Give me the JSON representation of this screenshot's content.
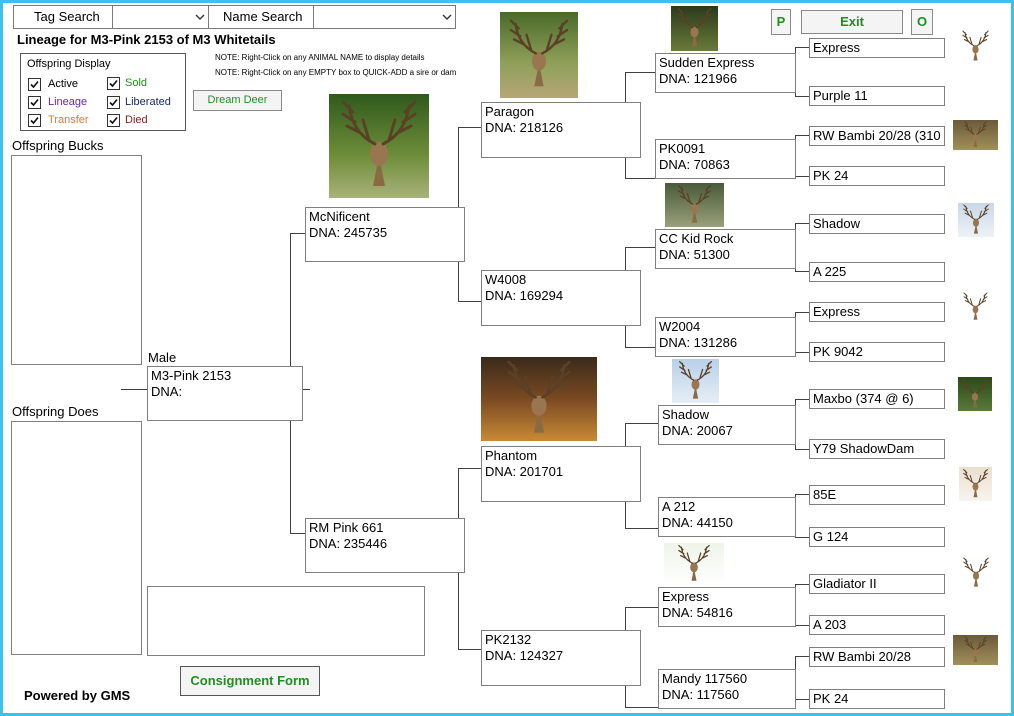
{
  "search": {
    "tag_label": "Tag Search",
    "name_label": "Name Search"
  },
  "header": {
    "title": "Lineage for M3-Pink 2153 of M3 Whitetails",
    "note1": "NOTE: Right-Click on any ANIMAL NAME to display details",
    "note2": "NOTE: Right-Click on any EMPTY box to QUICK-ADD a sire or dam"
  },
  "buttons": {
    "p": "P",
    "exit": "Exit",
    "o": "O",
    "dream": "Dream Deer",
    "consignment": "Consignment Form"
  },
  "offspring_display": {
    "title": "Offspring Display",
    "items": [
      {
        "label": "Active",
        "color": "#000000",
        "checked": true
      },
      {
        "label": "Sold",
        "color": "#1f8f1f",
        "checked": true
      },
      {
        "label": "Lineage",
        "color": "#6a2a9a",
        "checked": true
      },
      {
        "label": "Liberated",
        "color": "#1a2a6a",
        "checked": true
      },
      {
        "label": "Transfer",
        "color": "#e07a3a",
        "checked": true
      },
      {
        "label": "Died",
        "color": "#8a1a1a",
        "checked": true
      }
    ]
  },
  "offspring": {
    "bucks_label": "Offspring Bucks",
    "does_label": "Offspring Does"
  },
  "footer": {
    "powered": "Powered by GMS"
  },
  "subject": {
    "sex": "Male",
    "name": "M3-Pink 2153",
    "dna": "DNA:"
  },
  "gen1": {
    "sire": {
      "name": "McNificent",
      "dna": "DNA: 245735"
    },
    "dam": {
      "name": "RM Pink 661",
      "dna": "DNA: 235446"
    }
  },
  "gen2": {
    "a": {
      "name": "Paragon",
      "dna": "DNA: 218126"
    },
    "b": {
      "name": "W4008",
      "dna": "DNA: 169294"
    },
    "c": {
      "name": "Phantom",
      "dna": "DNA: 201701"
    },
    "d": {
      "name": "PK2132",
      "dna": "DNA: 124327"
    }
  },
  "gen3": {
    "a": {
      "name": "Sudden Express",
      "dna": "DNA: 121966"
    },
    "b": {
      "name": "PK0091",
      "dna": "DNA: 70863"
    },
    "c": {
      "name": "CC Kid Rock",
      "dna": "DNA: 51300"
    },
    "d": {
      "name": "W2004",
      "dna": "DNA: 131286"
    },
    "e": {
      "name": "Shadow",
      "dna": "DNA: 20067"
    },
    "f": {
      "name": "A 212",
      "dna": "DNA: 44150"
    },
    "g": {
      "name": "Express",
      "dna": "DNA: 54816"
    },
    "h": {
      "name": "Mandy 117560",
      "dna": "DNA: 117560"
    }
  },
  "gen4": [
    "Express",
    "Purple 11",
    "RW Bambi 20/28 (310",
    "PK 24",
    "Shadow",
    "A 225",
    "Express",
    "PK 9042",
    "Maxbo (374 @ 6)",
    "Y79 ShadowDam",
    "85E",
    "G 124",
    "Gladiator II",
    "A 203",
    "RW Bambi 20/28",
    "PK 24"
  ]
}
